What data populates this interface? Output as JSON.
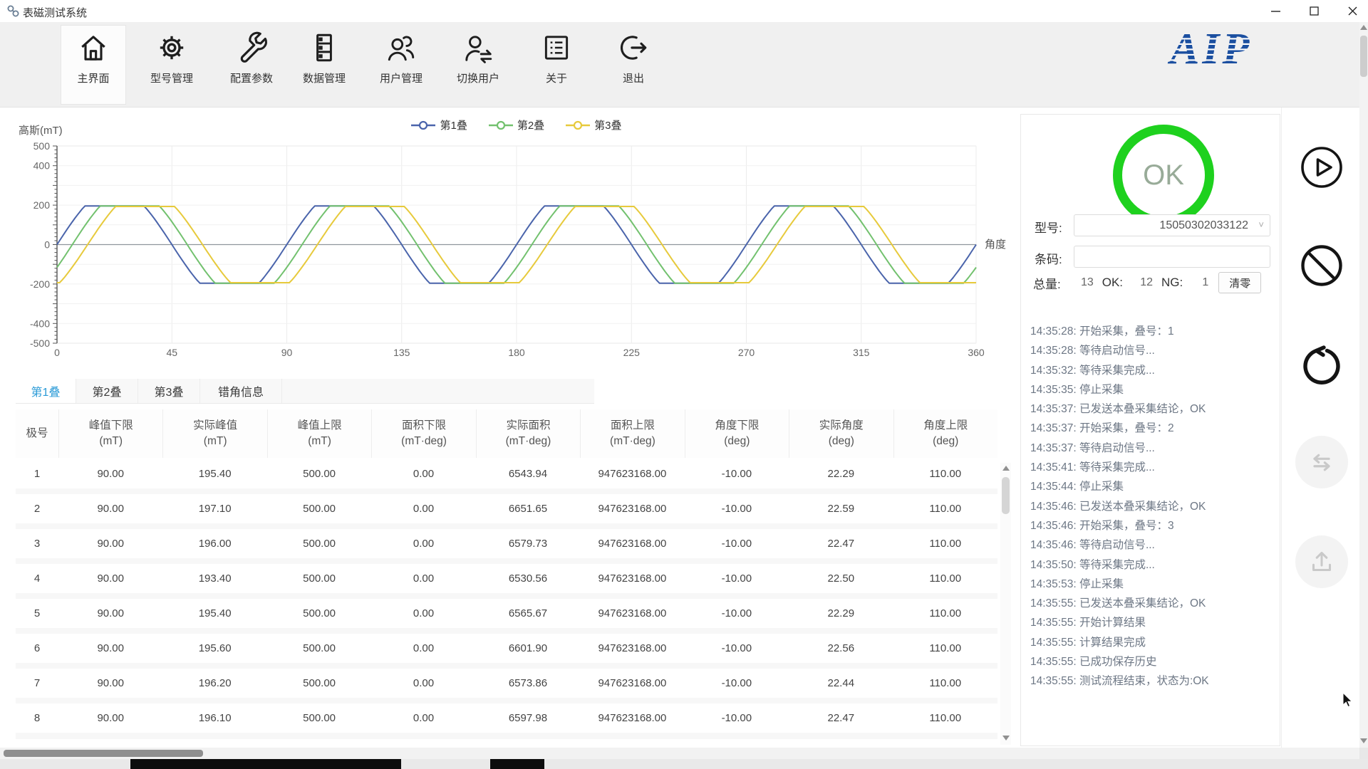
{
  "window": {
    "title": "表磁测试系统"
  },
  "toolbar": {
    "logo_text": "AIP",
    "items": [
      {
        "id": "home",
        "icon": "home",
        "label": "主界面",
        "active": true
      },
      {
        "id": "model-mgmt",
        "icon": "gear",
        "label": "型号管理",
        "active": false
      },
      {
        "id": "config",
        "icon": "wrench",
        "label": "配置参数",
        "active": false
      },
      {
        "id": "data-mgmt",
        "icon": "storage",
        "label": "数据管理",
        "active": false
      },
      {
        "id": "user-mgmt",
        "icon": "users",
        "label": "用户管理",
        "active": false
      },
      {
        "id": "switch-user",
        "icon": "switch",
        "label": "切换用户",
        "active": false
      },
      {
        "id": "about",
        "icon": "list",
        "label": "关于",
        "active": false
      },
      {
        "id": "exit",
        "icon": "exit",
        "label": "退出",
        "active": false
      }
    ]
  },
  "chart_data": {
    "type": "line",
    "title": "",
    "xlabel": "角度",
    "ylabel": "高斯(mT)",
    "xlim": [
      0,
      360
    ],
    "ylim": [
      -500,
      500
    ],
    "x_ticks": [
      0,
      45,
      90,
      135,
      180,
      225,
      270,
      315,
      360
    ],
    "y_tick_labels": [
      500,
      400,
      200,
      0,
      -200,
      -400,
      -500
    ],
    "grid": true,
    "legend_position": "top-center",
    "waveform": {
      "shape": "clipped-sine",
      "period_deg": 90,
      "clip_factor": 1.45
    },
    "series": [
      {
        "name": "第1叠",
        "color": "#4a64ab",
        "phase_deg": 0,
        "amplitude_mT": 196
      },
      {
        "name": "第2叠",
        "color": "#72c16e",
        "phase_deg": 6,
        "amplitude_mT": 196
      },
      {
        "name": "第3叠",
        "color": "#e7ca3c",
        "phase_deg": 12,
        "amplitude_mT": 193
      }
    ]
  },
  "tabs": [
    {
      "id": "stack1",
      "label": "第1叠",
      "active": true
    },
    {
      "id": "stack2",
      "label": "第2叠",
      "active": false
    },
    {
      "id": "stack3",
      "label": "第3叠",
      "active": false
    },
    {
      "id": "angle-error",
      "label": "错角信息",
      "active": false
    }
  ],
  "table": {
    "columns": [
      {
        "title": "极号",
        "unit": ""
      },
      {
        "title": "峰值下限",
        "unit": "(mT)"
      },
      {
        "title": "实际峰值",
        "unit": "(mT)"
      },
      {
        "title": "峰值上限",
        "unit": "(mT)"
      },
      {
        "title": "面积下限",
        "unit": "(mT·deg)"
      },
      {
        "title": "实际面积",
        "unit": "(mT·deg)"
      },
      {
        "title": "面积上限",
        "unit": "(mT·deg)"
      },
      {
        "title": "角度下限",
        "unit": "(deg)"
      },
      {
        "title": "实际角度",
        "unit": "(deg)"
      },
      {
        "title": "角度上限",
        "unit": "(deg)"
      }
    ],
    "rows": [
      [
        "1",
        "90.00",
        "195.40",
        "500.00",
        "0.00",
        "6543.94",
        "947623168.00",
        "-10.00",
        "22.29",
        "110.00"
      ],
      [
        "2",
        "90.00",
        "197.10",
        "500.00",
        "0.00",
        "6651.65",
        "947623168.00",
        "-10.00",
        "22.59",
        "110.00"
      ],
      [
        "3",
        "90.00",
        "196.00",
        "500.00",
        "0.00",
        "6579.73",
        "947623168.00",
        "-10.00",
        "22.47",
        "110.00"
      ],
      [
        "4",
        "90.00",
        "193.40",
        "500.00",
        "0.00",
        "6530.56",
        "947623168.00",
        "-10.00",
        "22.50",
        "110.00"
      ],
      [
        "5",
        "90.00",
        "195.40",
        "500.00",
        "0.00",
        "6565.67",
        "947623168.00",
        "-10.00",
        "22.29",
        "110.00"
      ],
      [
        "6",
        "90.00",
        "195.60",
        "500.00",
        "0.00",
        "6601.90",
        "947623168.00",
        "-10.00",
        "22.56",
        "110.00"
      ],
      [
        "7",
        "90.00",
        "196.20",
        "500.00",
        "0.00",
        "6573.86",
        "947623168.00",
        "-10.00",
        "22.44",
        "110.00"
      ],
      [
        "8",
        "90.00",
        "196.10",
        "500.00",
        "0.00",
        "6597.98",
        "947623168.00",
        "-10.00",
        "22.47",
        "110.00"
      ]
    ]
  },
  "panel": {
    "status_text": "OK",
    "status_color": "#1ed11e",
    "model_label": "型号:",
    "model_value": "15050302033122",
    "barcode_label": "条码:",
    "barcode_value": "",
    "total_label": "总量:",
    "total_value": "13",
    "ok_label": "OK:",
    "ok_value": "12",
    "ng_label": "NG:",
    "ng_value": "1",
    "clear_button": "清零"
  },
  "log": [
    "14:35:28: 开始采集，叠号：1",
    "14:35:28: 等待启动信号...",
    "14:35:32: 等待采集完成...",
    "14:35:35: 停止采集",
    "14:35:37: 已发送本叠采集结论，OK",
    "14:35:37: 开始采集，叠号：2",
    "14:35:37: 等待启动信号...",
    "14:35:41: 等待采集完成...",
    "14:35:44: 停止采集",
    "14:35:46: 已发送本叠采集结论，OK",
    "14:35:46: 开始采集，叠号：3",
    "14:35:46: 等待启动信号...",
    "14:35:50: 等待采集完成...",
    "14:35:53: 停止采集",
    "14:35:55: 已发送本叠采集结论，OK",
    "14:35:55: 开始计算结果",
    "14:35:55: 计算结果完成",
    "14:35:55: 已成功保存历史",
    "14:35:55: 测试流程结束，状态为:OK"
  ],
  "side_buttons": [
    {
      "id": "start",
      "icon": "play",
      "enabled": true
    },
    {
      "id": "stop",
      "icon": "ban",
      "enabled": true
    },
    {
      "id": "reset",
      "icon": "rotate",
      "enabled": true
    },
    {
      "id": "transfer",
      "icon": "swap",
      "enabled": false
    },
    {
      "id": "upload",
      "icon": "upload",
      "enabled": false
    }
  ]
}
